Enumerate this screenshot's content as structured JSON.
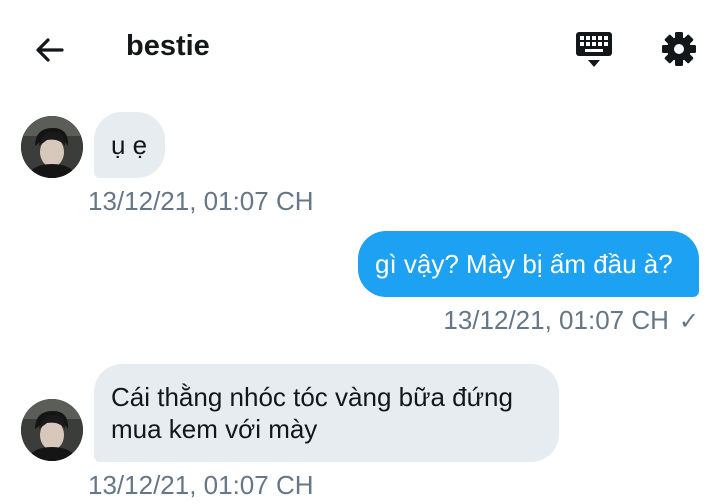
{
  "header": {
    "back_icon": "arrow-left-icon",
    "title": "bestie",
    "keyboard_icon": "keyboard-icon",
    "settings_icon": "gear-icon"
  },
  "messages": [
    {
      "direction": "incoming",
      "text": "ụ ẹ",
      "timestamp": "13/12/21, 01:07 CH"
    },
    {
      "direction": "outgoing",
      "text": "gì vậy? Mày bị ấm đầu à?",
      "timestamp": "13/12/21, 01:07 CH",
      "status_icon": "checkmark-icon"
    },
    {
      "direction": "incoming",
      "text_lines": [
        "Cái thằng nhóc tóc vàng bữa đứng",
        "mua kem với mày"
      ],
      "timestamp": "13/12/21, 01:07 CH"
    }
  ],
  "colors": {
    "outgoing_bubble": "#1da1f2",
    "incoming_bubble": "#e6ecf0",
    "timestamp": "#657786"
  }
}
